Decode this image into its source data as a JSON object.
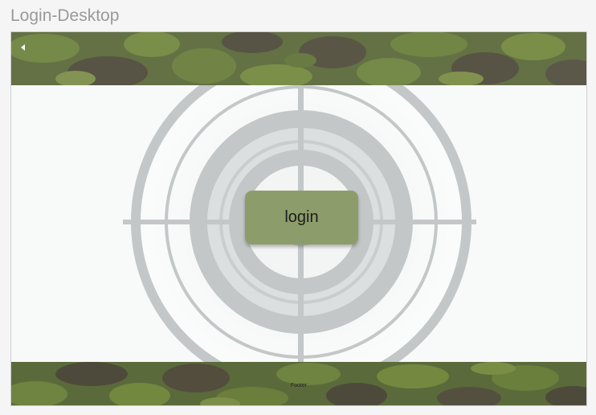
{
  "frame": {
    "title": "Login-Desktop"
  },
  "header": {
    "back_icon": "caret-left-icon",
    "background": "camouflage-pattern"
  },
  "main": {
    "background_graphic": "crosshair-target",
    "login_label": "login"
  },
  "footer": {
    "label": "Footer",
    "background": "camouflage-pattern"
  },
  "colors": {
    "page_background": "#f5f5f5",
    "title_text": "#9a9a9a",
    "camo_base": "#5b6a3a",
    "camo_light": "#6e8440",
    "camo_dark": "#4e4a3b",
    "button": "#8c9d6b",
    "target_ring": "#c3c7c8"
  }
}
